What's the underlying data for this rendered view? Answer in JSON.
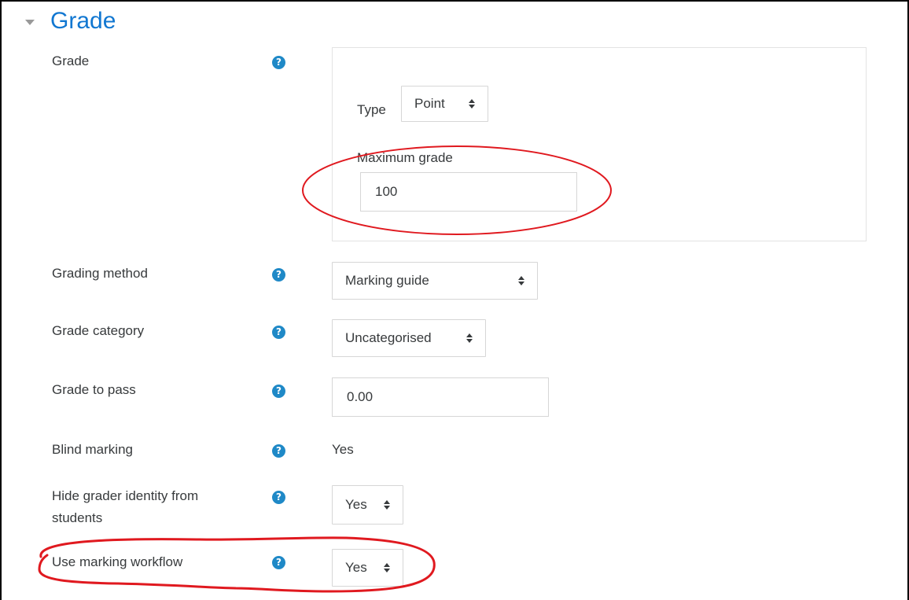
{
  "section": {
    "title": "Grade"
  },
  "grade": {
    "label": "Grade",
    "type_label": "Type",
    "type_value": "Point",
    "max_grade_label": "Maximum grade",
    "max_grade_value": "100"
  },
  "grading_method": {
    "label": "Grading method",
    "value": "Marking guide"
  },
  "grade_category": {
    "label": "Grade category",
    "value": "Uncategorised"
  },
  "grade_to_pass": {
    "label": "Grade to pass",
    "value": "0.00"
  },
  "blind_marking": {
    "label": "Blind marking",
    "value": "Yes"
  },
  "hide_grader": {
    "label_line1": "Hide grader identity from",
    "label_line2": "students",
    "value": "Yes"
  },
  "marking_workflow": {
    "label": "Use marking workflow",
    "value": "Yes"
  },
  "help_glyph": "?",
  "colors": {
    "accent": "#1177d1",
    "help_icon": "#1f89c7",
    "annotation": "#e0191f"
  }
}
